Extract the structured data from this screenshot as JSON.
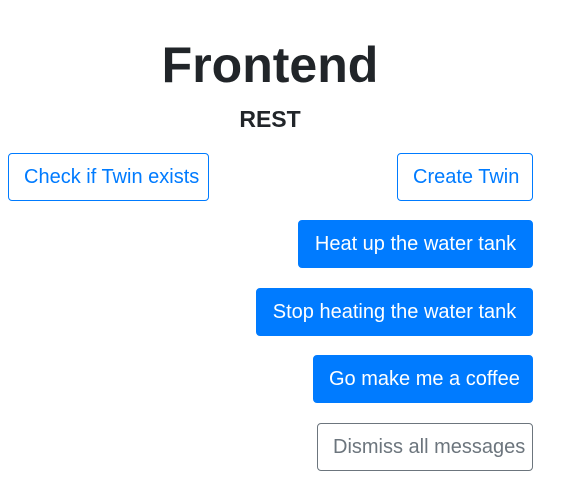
{
  "header": {
    "title": "Frontend",
    "subtitle": "REST"
  },
  "buttons": {
    "check_twin": "Check if Twin exists",
    "create_twin": "Create Twin",
    "heat_tank": "Heat up the water tank",
    "stop_heating": "Stop heating the water tank",
    "make_coffee": "Go make me a coffee",
    "dismiss_messages": "Dismiss all messages"
  },
  "colors": {
    "primary": "#007bff",
    "secondary": "#6c757d",
    "text": "#212529"
  }
}
